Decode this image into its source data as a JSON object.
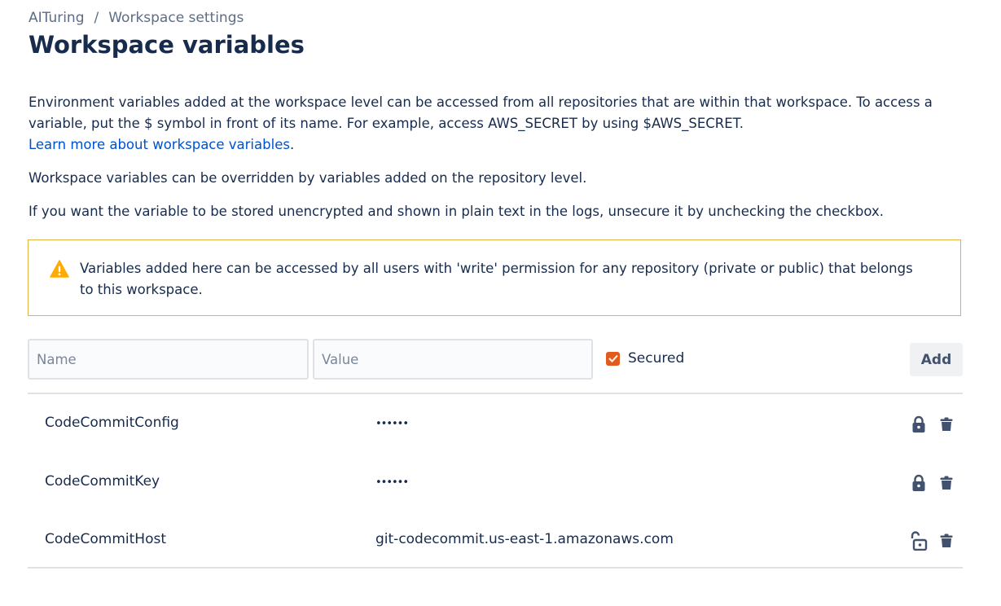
{
  "breadcrumb": {
    "root": "AITuring",
    "separator": "/",
    "current": "Workspace settings"
  },
  "page_title": "Workspace variables",
  "description": {
    "paragraph1_text": "Environment variables added at the workspace level can be accessed from all repositories that are within that workspace. To access a variable, put the $ symbol in front of its name. For example, access AWS_SECRET by using $AWS_SECRET.",
    "learn_more_link": "Learn more about workspace variables",
    "learn_more_suffix": ".",
    "paragraph2": "Workspace variables can be overridden by variables added on the repository level.",
    "paragraph3": "If you want the variable to be stored unencrypted and shown in plain text in the logs, unsecure it by unchecking the checkbox."
  },
  "warning": {
    "icon": "warning-triangle-icon",
    "text": "Variables added here can be accessed by all users with 'write' permission for any repository (private or public) that belongs to this workspace.",
    "border_color": "#dfb440",
    "icon_color": "#ffab00"
  },
  "form": {
    "name_placeholder": "Name",
    "name_value": "",
    "value_placeholder": "Value",
    "value_value": "",
    "secured_label": "Secured",
    "secured_checked": true,
    "checkbox_color": "#e35a1f",
    "add_label": "Add"
  },
  "variables": [
    {
      "name": "CodeCommitConfig",
      "value": "••••••",
      "secured": true,
      "lock_icon": "lock-closed-icon",
      "delete_icon": "trash-icon"
    },
    {
      "name": "CodeCommitKey",
      "value": "••••••",
      "secured": true,
      "lock_icon": "lock-closed-icon",
      "delete_icon": "trash-icon"
    },
    {
      "name": "CodeCommitHost",
      "value": "git-codecommit.us-east-1.amazonaws.com",
      "secured": false,
      "lock_icon": "lock-open-icon",
      "delete_icon": "trash-icon"
    }
  ],
  "colors": {
    "text": "#172b4d",
    "link": "#0052cc",
    "muted": "#5e6c84",
    "icon": "#42526e"
  }
}
